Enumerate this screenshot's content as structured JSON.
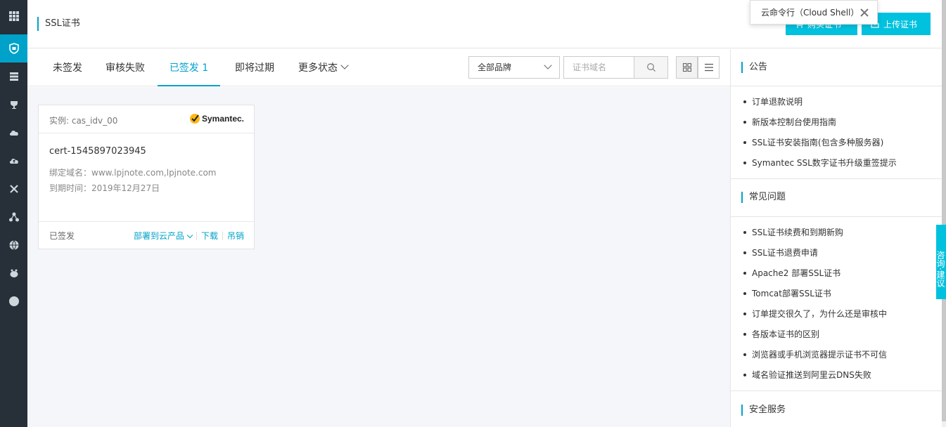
{
  "colors": {
    "accent": "#00a2ca",
    "primary_button": "#00c1de",
    "rail_bg": "#273038"
  },
  "rail": {
    "items": [
      {
        "icon": "grid-icon"
      },
      {
        "icon": "shield-icon",
        "active": true
      },
      {
        "icon": "database-icon"
      },
      {
        "icon": "trophy-icon"
      },
      {
        "icon": "cloud-icon"
      },
      {
        "icon": "cloud-upload-icon"
      },
      {
        "icon": "tools-icon"
      },
      {
        "icon": "cluster-icon"
      },
      {
        "icon": "globe-icon"
      },
      {
        "icon": "pig-icon"
      },
      {
        "icon": "circle-icon"
      }
    ]
  },
  "header": {
    "title": "SSL证书",
    "buy_label": "购买证书",
    "upload_label": "上传证书"
  },
  "cloud_shell": {
    "label": "云命令行（Cloud Shell）"
  },
  "tabs": [
    {
      "label": "未签发"
    },
    {
      "label": "审核失败"
    },
    {
      "label": "已签发",
      "count": "1",
      "active": true
    },
    {
      "label": "即将过期"
    },
    {
      "label": "更多状态"
    }
  ],
  "filters": {
    "brand_select": "全部品牌",
    "search_placeholder": "证书域名"
  },
  "card": {
    "instance": "实例: cas_idv_00",
    "brand": "Symantec.",
    "cert_name": "cert-1545897023945",
    "domain": "绑定域名：www.lpjnote.com,lpjnote.com",
    "expiry": "到期时间：2019年12月27日",
    "status": "已签发",
    "deploy_label": "部署到云产品",
    "download_label": "下载",
    "revoke_label": "吊销"
  },
  "sidebar": {
    "announce_title": "公告",
    "announce_items": [
      "订单退款说明",
      "新版本控制台使用指南",
      "SSL证书安装指南(包含多种服务器)",
      "Symantec SSL数字证书升级重签提示"
    ],
    "faq_title": "常见问题",
    "faq_items": [
      "SSL证书续费和到期新购",
      "SSL证书退费申请",
      "Apache2 部署SSL证书",
      "Tomcat部署SSL证书",
      "订单提交很久了，为什么还是审核中",
      "各版本证书的区别",
      "浏览器或手机浏览器提示证书不可信",
      "域名验证推送到阿里云DNS失败"
    ],
    "security_title": "安全服务"
  },
  "consult": {
    "label": "咨询·建议"
  }
}
